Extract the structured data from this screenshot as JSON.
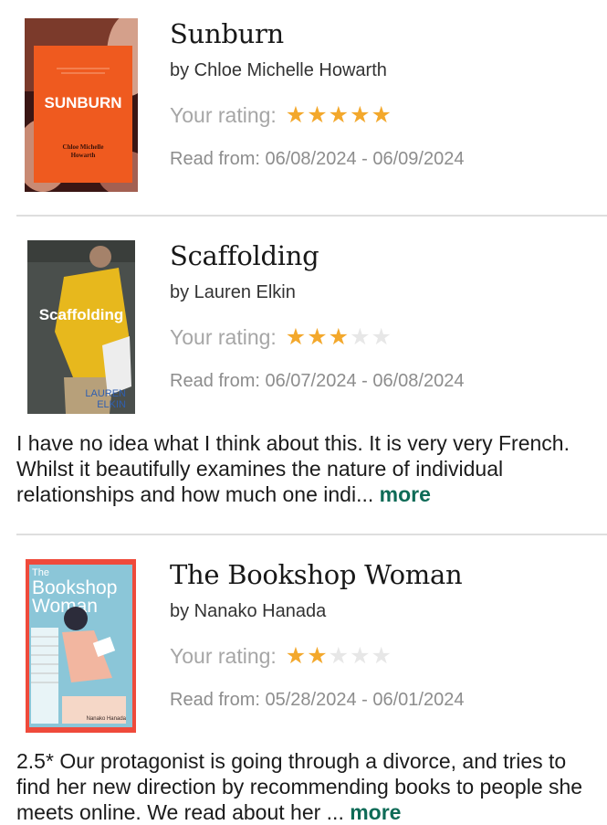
{
  "books": [
    {
      "title": "Sunburn",
      "author": "by Chloe Michelle Howarth",
      "rating_label": "Your rating:",
      "rating": 5,
      "rating_max": 5,
      "dates": "Read from: 06/08/2024 - 06/09/2024",
      "cover": {
        "title_text": "SUNBURN",
        "author_line1": "Chloe Michelle",
        "author_line2": "Howarth",
        "bg_color": "#ef5a1f"
      }
    },
    {
      "title": "Scaffolding",
      "author": "by Lauren Elkin",
      "rating_label": "Your rating:",
      "rating": 3,
      "rating_max": 5,
      "dates": "Read from: 06/07/2024 - 06/08/2024",
      "review_text": "I have no idea what I think about this. It is very very French. Whilst it beautifully examines the nature of individual relationships and how much one indi...",
      "more_label": "more",
      "cover": {
        "title_text": "Scaffolding",
        "author_line1": "LAUREN",
        "author_line2": "ELKIN",
        "bg_color": "#4a4f4c"
      }
    },
    {
      "title": "The Bookshop Woman",
      "author": "by Nanako Hanada",
      "rating_label": "Your rating:",
      "rating": 2,
      "rating_max": 5,
      "dates": "Read from: 05/28/2024 - 06/01/2024",
      "review_text": "2.5* Our protagonist is going through a divorce, and tries to find her new direction by recommending books to people she meets online. We read about her ...",
      "more_label": "more",
      "cover": {
        "title_line1": "The",
        "title_line2": "Bookshop",
        "title_line3": "Woman",
        "author_text": "Nanako Hanada",
        "bg_color": "#ef4a3b"
      }
    }
  ],
  "colors": {
    "star_filled": "#f3a82c",
    "star_empty": "#e7e7e7",
    "more_link": "#0e6b57",
    "divider": "#dedede"
  },
  "icons": {
    "star": "star-icon"
  }
}
